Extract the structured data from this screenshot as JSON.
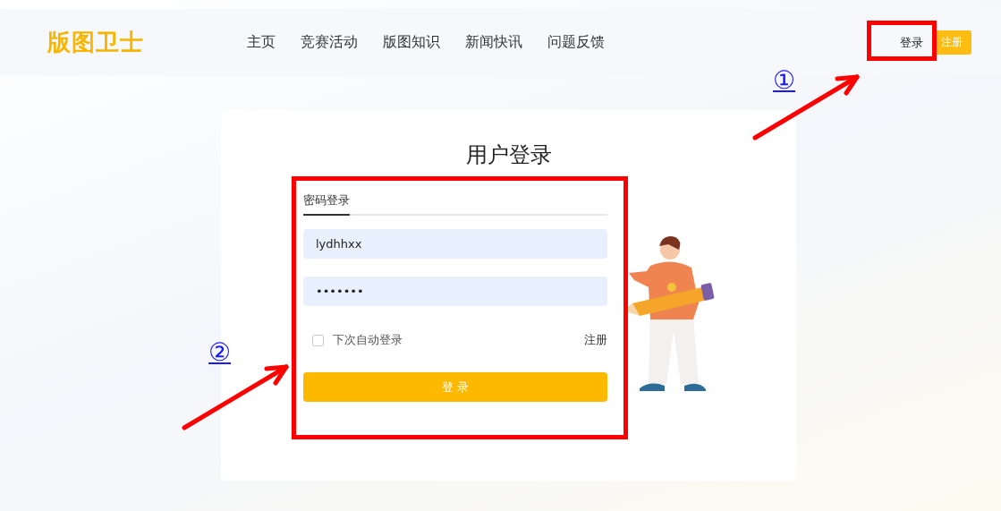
{
  "header": {
    "logo": "版图卫士",
    "nav": [
      {
        "label": "主页"
      },
      {
        "label": "竞赛活动"
      },
      {
        "label": "版图知识"
      },
      {
        "label": "新闻快讯"
      },
      {
        "label": "问题反馈"
      }
    ],
    "login_link": "登录",
    "register_button": "注册"
  },
  "login_card": {
    "title": "用户登录",
    "tabs": [
      {
        "label": "密码登录",
        "selected": true
      }
    ],
    "username": "lydhhxx",
    "password": "•••••••",
    "remember": {
      "label": "下次自动登录",
      "checked": false
    },
    "register_link": "注册",
    "submit": "登 录"
  },
  "annotations": [
    {
      "label": "①"
    },
    {
      "label": "②"
    }
  ]
}
